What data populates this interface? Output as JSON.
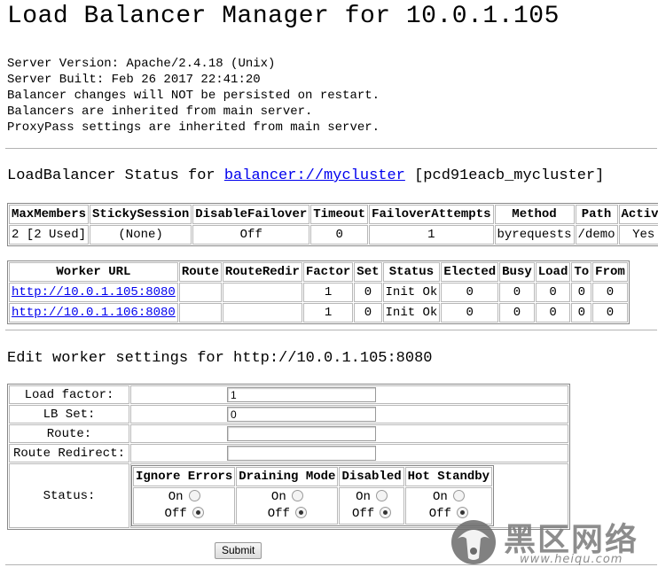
{
  "title": "Load Balancer Manager for 10.0.1.105",
  "info_lines": [
    "Server Version: Apache/2.4.18 (Unix)",
    "Server Built: Feb 26 2017 22:41:20",
    "Balancer changes will NOT be persisted on restart.",
    "Balancers are inherited from main server.",
    "ProxyPass settings are inherited from main server."
  ],
  "status": {
    "prefix": "LoadBalancer Status for ",
    "link": "balancer://mycluster",
    "suffix": " [pcd91eacb_mycluster]"
  },
  "balancer_table": {
    "headers": [
      "MaxMembers",
      "StickySession",
      "DisableFailover",
      "Timeout",
      "FailoverAttempts",
      "Method",
      "Path",
      "Active"
    ],
    "row": [
      "2 [2 Used]",
      "(None)",
      "Off",
      "0",
      "1",
      "byrequests",
      "/demo",
      "Yes"
    ]
  },
  "worker_table": {
    "headers": [
      "Worker URL",
      "Route",
      "RouteRedir",
      "Factor",
      "Set",
      "Status",
      "Elected",
      "Busy",
      "Load",
      "To",
      "From"
    ],
    "rows": [
      [
        "http://10.0.1.105:8080",
        "",
        "",
        "1",
        "0",
        "Init Ok",
        "0",
        "0",
        "0",
        "0",
        "0"
      ],
      [
        "http://10.0.1.106:8080",
        "",
        "",
        "1",
        "0",
        "Init Ok",
        "0",
        "0",
        "0",
        "0",
        "0"
      ]
    ]
  },
  "edit": {
    "heading": "Edit worker settings for http://10.0.1.105:8080",
    "load_factor_label": "Load factor:",
    "load_factor_value": "1",
    "lb_set_label": "LB Set:",
    "lb_set_value": "0",
    "route_label": "Route:",
    "route_value": "",
    "route_redirect_label": "Route Redirect:",
    "route_redirect_value": "",
    "status_label": "Status:",
    "status_headers": [
      "Ignore Errors",
      "Draining Mode",
      "Disabled",
      "Hot Standby"
    ],
    "on_label": "On",
    "off_label": "Off",
    "selected": "Off",
    "submit_label": "Submit"
  },
  "watermark": {
    "text": "黑区网络",
    "url": "www.heiqu.com"
  }
}
